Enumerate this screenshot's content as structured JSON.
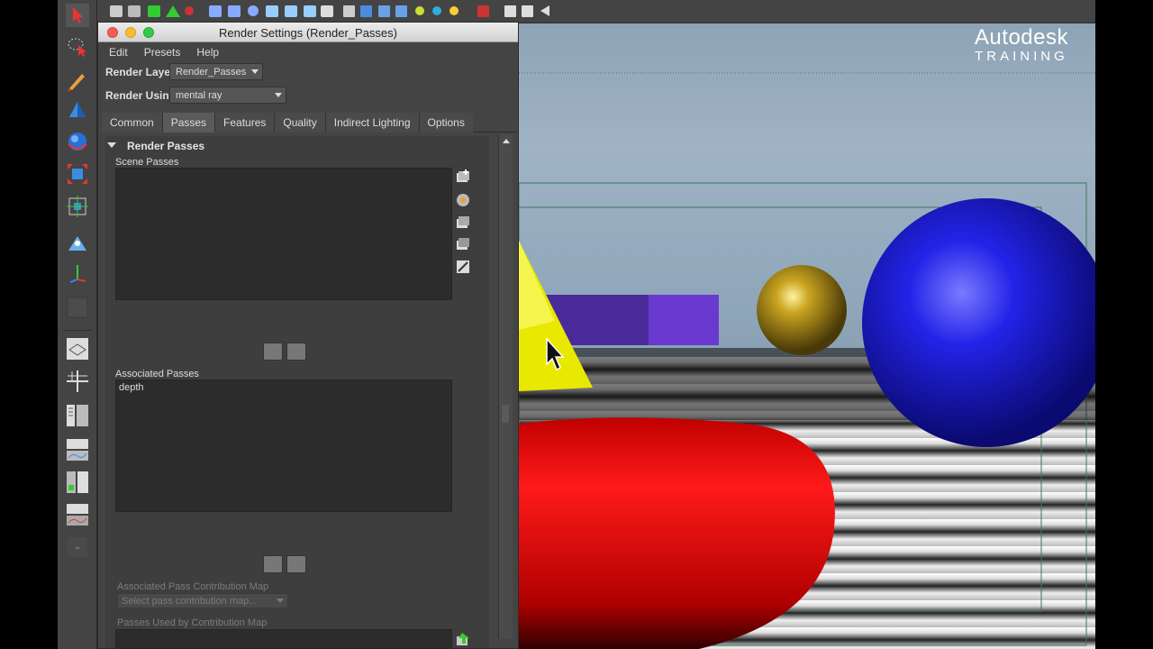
{
  "window": {
    "title": "Render Settings (Render_Passes)",
    "menu": [
      "Edit",
      "Presets",
      "Help"
    ]
  },
  "render_layer": {
    "label": "Render Layer",
    "value": "Render_Passes"
  },
  "render_using": {
    "label": "Render Using",
    "value": "mental ray"
  },
  "tabs": [
    {
      "label": "Common",
      "active": false
    },
    {
      "label": "Passes",
      "active": true
    },
    {
      "label": "Features",
      "active": false
    },
    {
      "label": "Quality",
      "active": false
    },
    {
      "label": "Indirect Lighting",
      "active": false
    },
    {
      "label": "Options",
      "active": false
    }
  ],
  "render_passes": {
    "heading": "Render Passes",
    "scene_passes_label": "Scene Passes",
    "scene_passes": [],
    "associated_passes_label": "Associated Passes",
    "associated_passes": [
      "depth"
    ],
    "contribution_map_label": "Associated Pass Contribution Map",
    "contribution_map_placeholder": "Select pass contribution map...",
    "passes_used_label": "Passes Used by Contribution Map"
  },
  "branding": {
    "line1": "Autodesk",
    "line2": "TRAINING"
  },
  "colors": {
    "torus": "#e00000",
    "cone": "#f2f200",
    "gold_sphere": "#a88a10",
    "blue_sphere": "#1c1ce0",
    "box": "#5a2ab0"
  }
}
